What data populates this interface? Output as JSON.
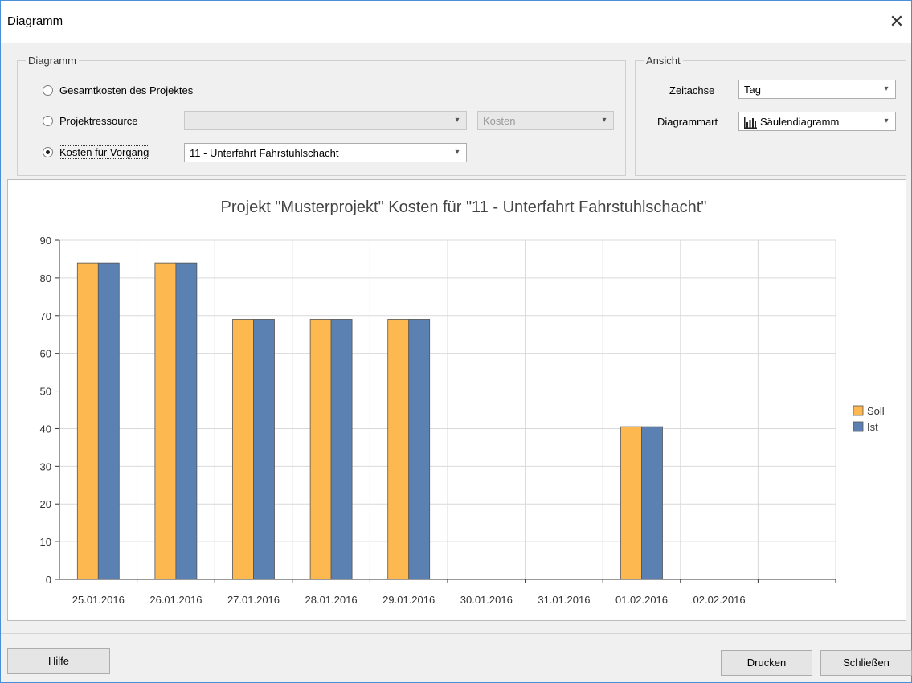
{
  "window": {
    "title": "Diagramm"
  },
  "diagram_group": {
    "legend": "Diagramm",
    "options": [
      {
        "label": "Gesamtkosten des Projektes",
        "checked": false
      },
      {
        "label": "Projektressource",
        "checked": false
      },
      {
        "label": "Kosten für Vorgang",
        "checked": true
      }
    ],
    "resource_value": "",
    "resource_metric": "Kosten",
    "task_value": "11 - Unterfahrt Fahrstuhlschacht"
  },
  "view_group": {
    "legend": "Ansicht",
    "timeaxis_label": "Zeitachse",
    "timeaxis_value": "Tag",
    "charttype_label": "Diagrammart",
    "charttype_value": "Säulendiagramm"
  },
  "chart_data": {
    "type": "bar",
    "title": "Projekt \"Musterprojekt\" Kosten für \"11 - Unterfahrt Fahrstuhlschacht\"",
    "xlabel": "",
    "ylabel": "",
    "ylim": [
      0,
      90
    ],
    "yticks": [
      0,
      10,
      20,
      30,
      40,
      50,
      60,
      70,
      80,
      90
    ],
    "categories": [
      "25.01.2016",
      "26.01.2016",
      "27.01.2016",
      "28.01.2016",
      "29.01.2016",
      "30.01.2016",
      "31.01.2016",
      "01.02.2016",
      "02.02.2016"
    ],
    "series": [
      {
        "name": "Soll",
        "color": "#fdb94f",
        "values": [
          84,
          84,
          69,
          69,
          69,
          0,
          0,
          40.5,
          0
        ]
      },
      {
        "name": "Ist",
        "color": "#5b80b2",
        "values": [
          84,
          84,
          69,
          69,
          69,
          0,
          0,
          40.5,
          0
        ]
      }
    ],
    "grid": true,
    "legend_position": "right"
  },
  "footer": {
    "help_label": "Hilfe",
    "print_label": "Drucken",
    "close_label": "Schließen"
  }
}
